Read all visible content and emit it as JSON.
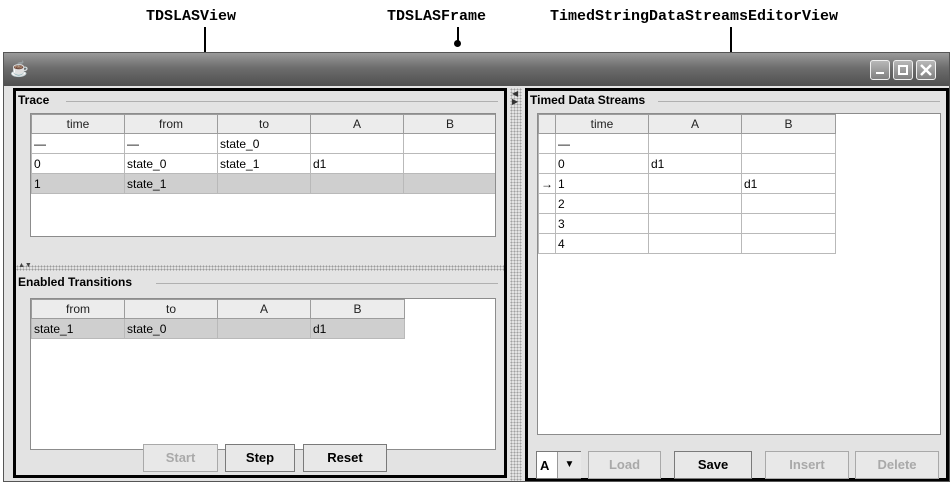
{
  "annotations": {
    "left_label": "TDSLASView",
    "center_label": "TDSLASFrame",
    "right_label": "TimedStringDataStreamsEditorView"
  },
  "window": {
    "title": "",
    "icon": "java-cup-icon",
    "controls": [
      "minimize-icon",
      "maximize-icon",
      "close-icon"
    ]
  },
  "trace": {
    "title": "Trace",
    "columns": [
      "time",
      "from",
      "to",
      "A",
      "B"
    ],
    "rows": [
      [
        "—",
        "—",
        "state_0",
        "",
        ""
      ],
      [
        "0",
        "state_0",
        "state_1",
        "d1",
        ""
      ],
      [
        "1",
        "state_1",
        "",
        "",
        ""
      ]
    ],
    "selected_row": 2
  },
  "enabled_transitions": {
    "title": "Enabled Transitions",
    "columns": [
      "from",
      "to",
      "A",
      "B"
    ],
    "rows": [
      [
        "state_1",
        "state_0",
        "",
        "d1"
      ]
    ],
    "selected_row": 0
  },
  "left_buttons": {
    "start": "Start",
    "step": "Step",
    "reset": "Reset"
  },
  "timed_data_streams": {
    "title": "Timed Data Streams",
    "columns": [
      "",
      "time",
      "A",
      "B"
    ],
    "rows": [
      [
        "",
        "—",
        "",
        ""
      ],
      [
        "",
        "0",
        "d1",
        ""
      ],
      [
        "→",
        "1",
        "",
        "d1"
      ],
      [
        "",
        "2",
        "",
        ""
      ],
      [
        "",
        "3",
        "",
        ""
      ],
      [
        "",
        "4",
        "",
        ""
      ]
    ]
  },
  "right_controls": {
    "stream_select": "A",
    "load": "Load",
    "save": "Save",
    "insert": "Insert",
    "delete": "Delete"
  }
}
